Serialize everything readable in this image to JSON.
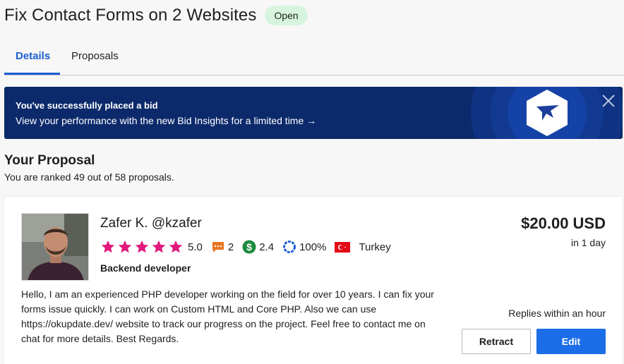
{
  "header": {
    "title": "Fix Contact Forms on 2 Websites",
    "status": "Open"
  },
  "tabs": [
    {
      "label": "Details",
      "active": true
    },
    {
      "label": "Proposals",
      "active": false
    }
  ],
  "banner": {
    "title": "You've successfully placed a bid",
    "link": "View your performance with the new Bid Insights for a limited time →"
  },
  "proposal": {
    "section_title": "Your Proposal",
    "rank_text": "You are ranked 49 out of 58 proposals."
  },
  "bid": {
    "name": "Zafer K.",
    "handle": "@kzafer",
    "rating": "5.0",
    "stars": 5,
    "reviews": "2",
    "earnings_score": "2.4",
    "completion": "100%",
    "country": "Turkey",
    "job_title": "Backend developer",
    "description": "Hello, I am an experienced PHP developer working on the field for over 10 years. I can fix your forms issue quickly. I can work on Custom HTML and Core PHP. Also we can use https://okupdate.dev/ website to track our progress on the project. Feel free to contact me on chat for more details. Best Regards.",
    "price": "$20.00 USD",
    "delivery": "in 1 day",
    "replies": "Replies within an hour",
    "retract_label": "Retract",
    "edit_label": "Edit"
  },
  "colors": {
    "accent": "#1c5fcf",
    "banner_bg": "#0c2a6b",
    "star": "#e0197d",
    "badge_bg": "#d7f5de",
    "edit_button": "#1c6ee8"
  }
}
